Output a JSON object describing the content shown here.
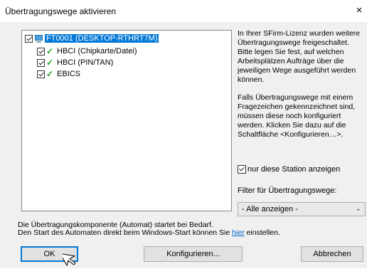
{
  "dialog": {
    "title": "Übertragungswege aktivieren",
    "close_glyph": "×"
  },
  "tree": {
    "root": {
      "label": "FT0001 (DESKTOP-RTHRT7M)",
      "checked": true,
      "selected": true
    },
    "children": [
      {
        "label": "HBCI (Chipkarte/Datei)",
        "checked": true
      },
      {
        "label": "HBCI (PIN/TAN)",
        "checked": true
      },
      {
        "label": "EBICS",
        "checked": true
      }
    ]
  },
  "info": {
    "p1": "In Ihrer SFirm-Lizenz wurden weitere Übertragungswege freigeschaltet. Bitte legen Sie fest, auf welchen Arbeitsplätzen Aufträge über die jeweiligen Wege ausgeführt werden können.",
    "p2": "Falls Übertragungswege mit einem Fragezeichen gekennzeichnet sind, müssen diese noch konfiguriert werden. Klicken Sie dazu auf die Schaltfläche <Konfigurieren…>."
  },
  "station_filter": {
    "label": "nur diese Station anzeigen",
    "checked": true
  },
  "filter": {
    "label": "Filter für Übertragungswege:",
    "selected": "- Alle anzeigen -",
    "arrow_glyph": "⌄"
  },
  "footer": {
    "line1": "Die Übertragungskomponente (Automat) startet bei Bedarf.",
    "line2_prefix": "Den Start des Automaten direkt beim Windows-Start können Sie ",
    "line2_link": "hier",
    "line2_suffix": " einstellen."
  },
  "buttons": {
    "ok": "OK",
    "configure": "Konfigurieren...",
    "cancel": "Abbrechen"
  },
  "colors": {
    "selection": "#0078d7",
    "check": "#1aa11a",
    "link": "#0066cc"
  }
}
